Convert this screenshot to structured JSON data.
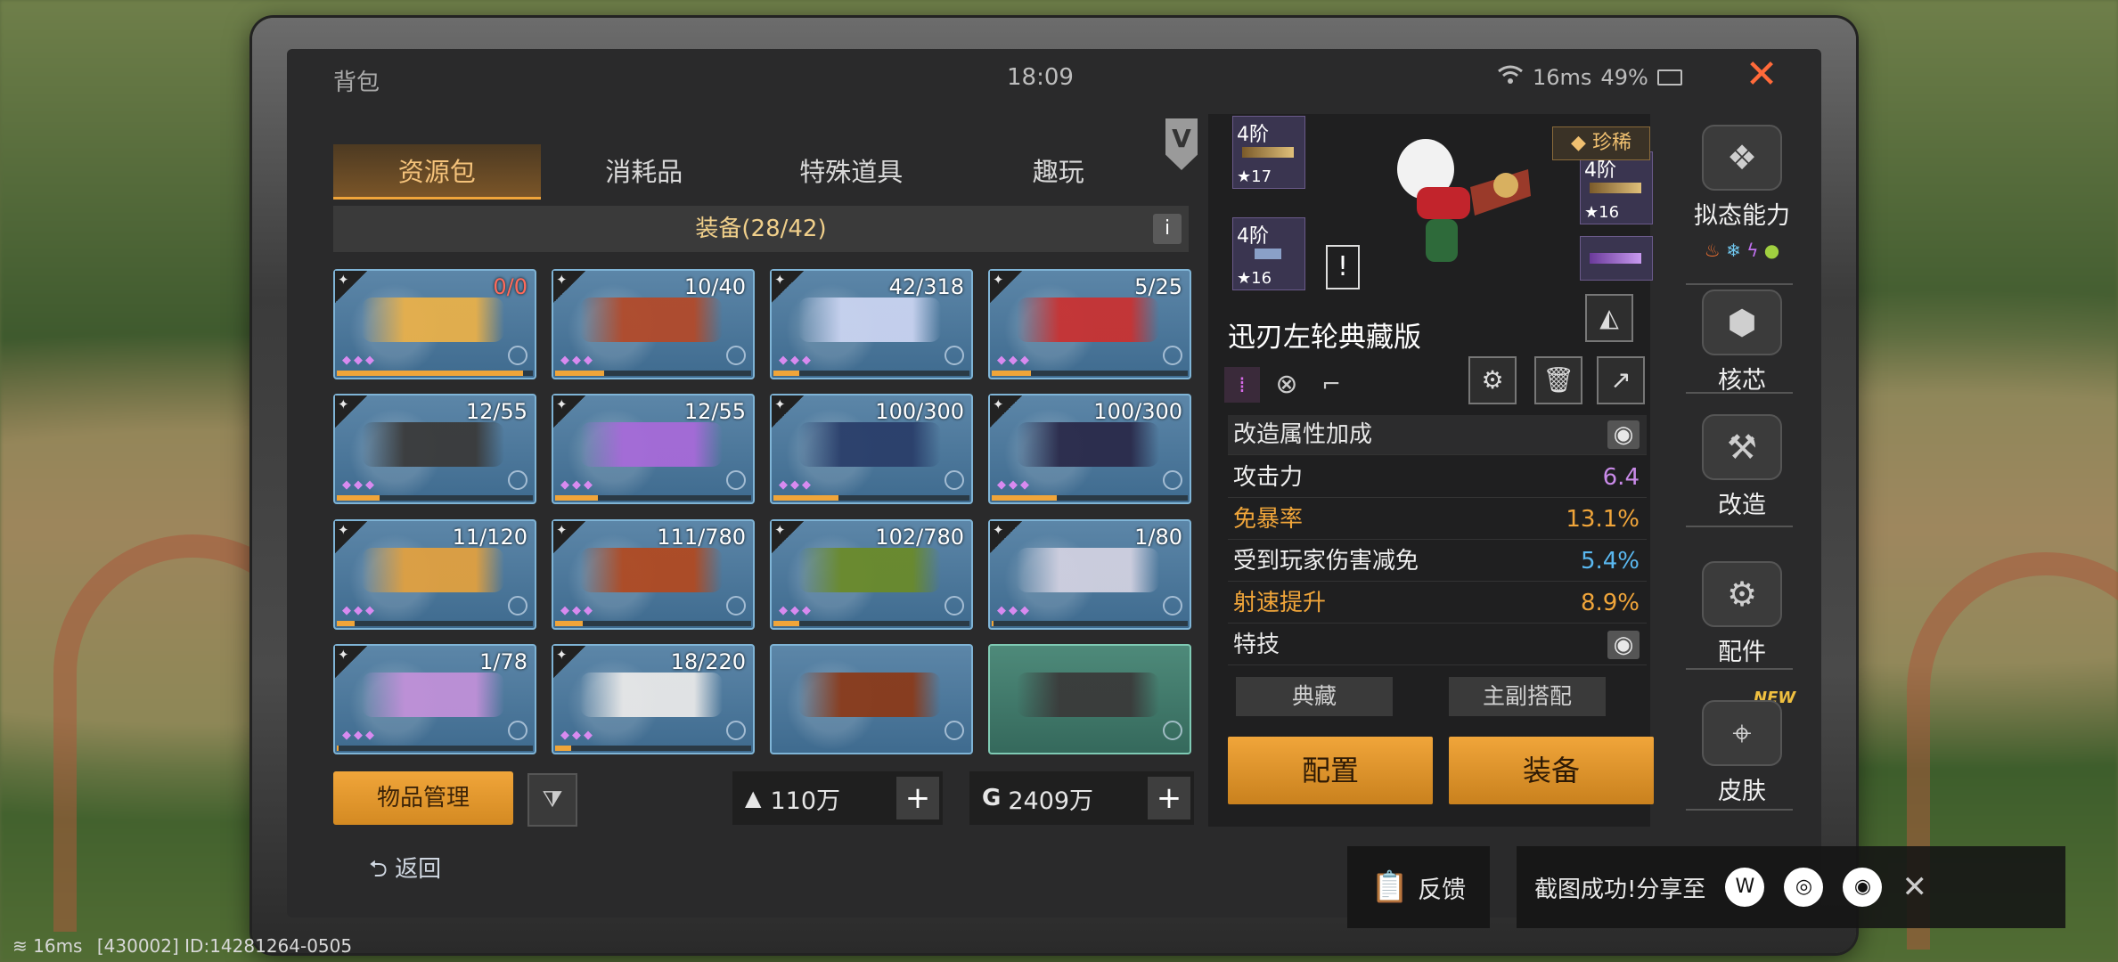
{
  "header": {
    "title": "背包",
    "time": "18:09",
    "latency": "16ms",
    "battery": "49%"
  },
  "tabs": [
    {
      "label": "资源包",
      "active": true
    },
    {
      "label": "消耗品",
      "active": false
    },
    {
      "label": "特殊道具",
      "active": false
    },
    {
      "label": "趣玩",
      "active": false
    }
  ],
  "vip_badge": "V",
  "equipment_header": "装备(28/42)",
  "info_icon": "i",
  "items": [
    {
      "count": "0/0",
      "red": true,
      "color": "#e8b04a",
      "progress": 0.95,
      "teal": false
    },
    {
      "count": "10/40",
      "red": false,
      "color": "#b24a2a",
      "progress": 0.25,
      "teal": false
    },
    {
      "count": "42/318",
      "red": false,
      "color": "#c9d3f0",
      "progress": 0.13,
      "teal": false
    },
    {
      "count": "5/25",
      "red": false,
      "color": "#c83232",
      "progress": 0.2,
      "teal": false
    },
    {
      "count": "12/55",
      "red": false,
      "color": "#3a3a3a",
      "progress": 0.22,
      "teal": false
    },
    {
      "count": "12/55",
      "red": false,
      "color": "#a66ad8",
      "progress": 0.22,
      "teal": false
    },
    {
      "count": "100/300",
      "red": false,
      "color": "#2a3e6a",
      "progress": 0.33,
      "teal": false
    },
    {
      "count": "100/300",
      "red": false,
      "color": "#2a2a4a",
      "progress": 0.33,
      "teal": false
    },
    {
      "count": "11/120",
      "red": false,
      "color": "#e0a040",
      "progress": 0.09,
      "teal": false
    },
    {
      "count": "111/780",
      "red": false,
      "color": "#b04a22",
      "progress": 0.14,
      "teal": false
    },
    {
      "count": "102/780",
      "red": false,
      "color": "#6a8a2a",
      "progress": 0.13,
      "teal": false
    },
    {
      "count": "1/80",
      "red": false,
      "color": "#d0d0e0",
      "progress": 0.01,
      "teal": false
    },
    {
      "count": "1/78",
      "red": false,
      "color": "#c090d8",
      "progress": 0.01,
      "teal": false
    },
    {
      "count": "18/220",
      "red": false,
      "color": "#e8e8e8",
      "progress": 0.08,
      "teal": false
    },
    {
      "count": "",
      "red": false,
      "color": "#8a3a1a",
      "progress": 0,
      "teal": false
    },
    {
      "count": "",
      "red": false,
      "color": "#3a3a3a",
      "progress": 0,
      "teal": true
    }
  ],
  "manage_button": "物品管理",
  "filter_icon": "filter-icon",
  "currency1": {
    "icon": "gold-pile-icon",
    "value": "110万",
    "plus": "+"
  },
  "currency2": {
    "icon": "coin-icon",
    "value": "2409万",
    "plus": "+"
  },
  "return_label": "返回",
  "detail": {
    "levels": [
      {
        "tier": "4阶",
        "stars": "17"
      },
      {
        "tier": "4阶",
        "stars": "16"
      },
      {
        "tier": "4阶",
        "stars": "16"
      }
    ],
    "rarity": "珍稀",
    "alert": "!",
    "weapon_name": "迅刃左轮典藏版",
    "stats_header": "改造属性加成",
    "stats": [
      {
        "label": "攻击力",
        "value": "6.4",
        "label_color": "#f0f0f0",
        "value_color": "#c98ae8"
      },
      {
        "label": "免暴率",
        "value": "13.1%",
        "label_color": "#f0a53a",
        "value_color": "#f0a53a"
      },
      {
        "label": "受到玩家伤害减免",
        "value": "5.4%",
        "label_color": "#f0f0f0",
        "value_color": "#5ab8f0"
      },
      {
        "label": "射速提升",
        "value": "8.9%",
        "label_color": "#f0a53a",
        "value_color": "#f0a53a"
      }
    ],
    "special": "特技",
    "gray_buttons": [
      "典藏",
      "主副搭配"
    ],
    "config_button": "配置",
    "equip_button": "装备"
  },
  "side_nav": [
    {
      "label": "拟态能力",
      "icon": "mimic-icon"
    },
    {
      "label": "核芯",
      "icon": "core-icon"
    },
    {
      "label": "改造",
      "icon": "modify-icon"
    },
    {
      "label": "配件",
      "icon": "parts-icon"
    },
    {
      "label": "皮肤",
      "icon": "skin-icon"
    }
  ],
  "new_tag": "NEW",
  "feedback_label": "反馈",
  "share_text": "截图成功!分享至",
  "status_line": "16ms",
  "status_ids": "[430002] ID:14281264-0505"
}
